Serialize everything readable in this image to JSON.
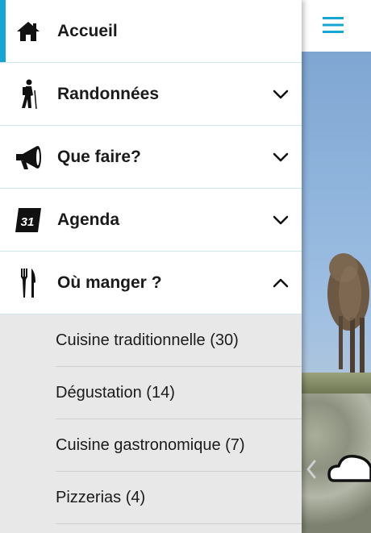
{
  "drawer": {
    "items": [
      {
        "label": "Accueil",
        "icon": "home-icon",
        "active": true,
        "expanded": null
      },
      {
        "label": "Randonnées",
        "icon": "hiker-icon",
        "active": false,
        "expanded": false
      },
      {
        "label": "Que faire?",
        "icon": "megaphone-icon",
        "active": false,
        "expanded": false
      },
      {
        "label": "Agenda",
        "icon": "calendar-icon",
        "active": false,
        "expanded": false,
        "icon_text": "31"
      },
      {
        "label": "Où manger ?",
        "icon": "fork-knife-icon",
        "active": false,
        "expanded": true
      }
    ],
    "submenu": [
      {
        "label": "Cuisine traditionnelle (30)"
      },
      {
        "label": "Dégustation (14)"
      },
      {
        "label": "Cuisine gastronomique (7)"
      },
      {
        "label": "Pizzerias (4)"
      }
    ]
  },
  "header": {
    "menu_icon": "hamburger-icon"
  },
  "weather": {
    "icon": "cloud-icon",
    "prev_icon": "chevron-left-icon"
  },
  "colors": {
    "accent": "#17a6d3",
    "divider": "#cfe7ec",
    "submenu_bg": "#e8e8e8",
    "text": "#1b1b1b"
  }
}
